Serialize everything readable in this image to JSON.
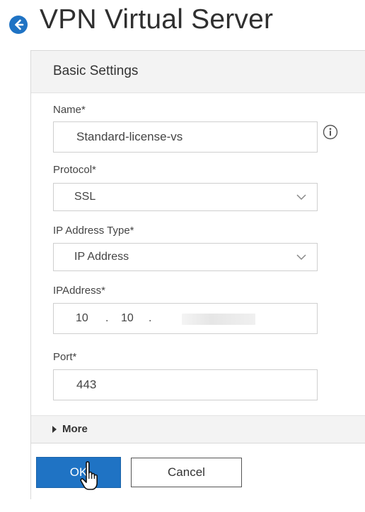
{
  "page": {
    "title": "VPN Virtual Server",
    "accent_color": "#1f73c4"
  },
  "panel": {
    "header_label": "Basic Settings"
  },
  "form": {
    "name": {
      "label": "Name*",
      "value": "Standard-license-vs",
      "help_icon": "info-icon"
    },
    "protocol": {
      "label": "Protocol*",
      "selected": "SSL"
    },
    "ip_address_type": {
      "label": "IP Address Type*",
      "selected": "IP Address"
    },
    "ip_address": {
      "label": "IPAddress*",
      "octet1": "10",
      "octet2": "10",
      "separator": "."
    },
    "port": {
      "label": "Port*",
      "value": "443"
    }
  },
  "more": {
    "label": "More"
  },
  "footer": {
    "ok_label": "OK",
    "cancel_label": "Cancel"
  }
}
